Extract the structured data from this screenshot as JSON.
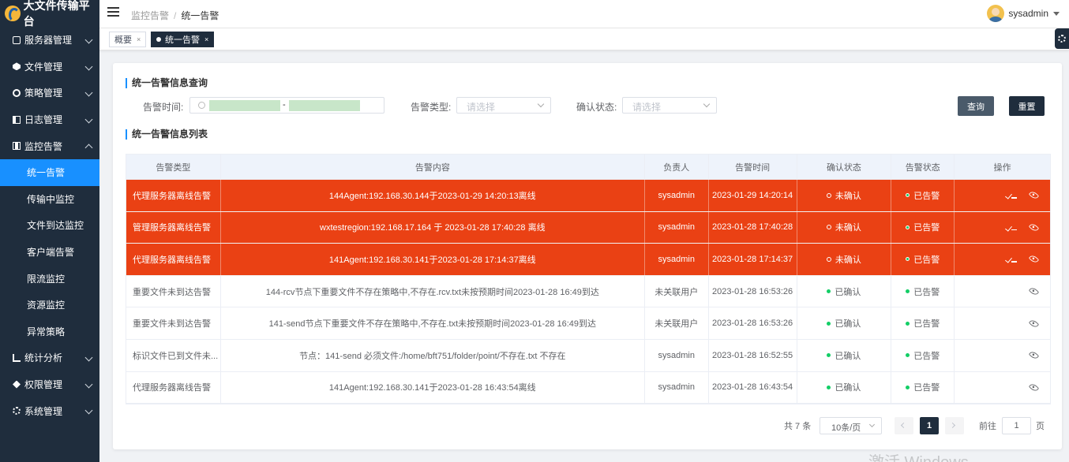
{
  "app": {
    "title": "大文件传输平台"
  },
  "sidebar": {
    "items": [
      {
        "label": "服务器管理",
        "icon": "server-icon"
      },
      {
        "label": "文件管理",
        "icon": "file-icon"
      },
      {
        "label": "策略管理",
        "icon": "policy-icon"
      },
      {
        "label": "日志管理",
        "icon": "log-icon"
      },
      {
        "label": "监控告警",
        "icon": "monitor-icon",
        "expanded": true,
        "children": [
          {
            "label": "统一告警",
            "active": true
          },
          {
            "label": "传输中监控"
          },
          {
            "label": "文件到达监控"
          },
          {
            "label": "客户端告警"
          },
          {
            "label": "限流监控"
          },
          {
            "label": "资源监控"
          },
          {
            "label": "异常策略"
          }
        ]
      },
      {
        "label": "统计分析",
        "icon": "stat-icon"
      },
      {
        "label": "权限管理",
        "icon": "permission-icon"
      },
      {
        "label": "系统管理",
        "icon": "system-icon"
      }
    ]
  },
  "header": {
    "breadcrumb": [
      "监控告警",
      "统一告警"
    ],
    "separator": "/",
    "user": "sysadmin"
  },
  "tabs": [
    {
      "label": "概要",
      "active": false
    },
    {
      "label": "统一告警",
      "active": true
    }
  ],
  "query": {
    "title": "统一告警信息查询",
    "alarm_time_label": "告警时间:",
    "range_separator": "-",
    "alarm_type_label": "告警类型:",
    "alarm_type_placeholder": "请选择",
    "confirm_status_label": "确认状态:",
    "confirm_status_placeholder": "请选择",
    "query_button": "查询",
    "reset_button": "重置"
  },
  "list": {
    "title": "统一告警信息列表",
    "columns": [
      "告警类型",
      "告警内容",
      "负责人",
      "告警时间",
      "确认状态",
      "告警状态",
      "操作"
    ],
    "rows": [
      {
        "type": "代理服务器离线告警",
        "content": "144Agent:192.168.30.144于2023-01-29 14:20:13离线",
        "owner": "sysadmin",
        "time": "2023-01-29 14:20:14",
        "confirm": "未确认",
        "alarm": "已告警",
        "highlight": true
      },
      {
        "type": "管理服务器离线告警",
        "content": "wxtestregion:192.168.17.164 于 2023-01-28 17:40:28 离线",
        "owner": "sysadmin",
        "time": "2023-01-28 17:40:28",
        "confirm": "未确认",
        "alarm": "已告警",
        "highlight": true
      },
      {
        "type": "代理服务器离线告警",
        "content": "141Agent:192.168.30.141于2023-01-28 17:14:37离线",
        "owner": "sysadmin",
        "time": "2023-01-28 17:14:37",
        "confirm": "未确认",
        "alarm": "已告警",
        "highlight": true
      },
      {
        "type": "重要文件未到达告警",
        "content": "144-rcv节点下重要文件不存在策略中,不存在.rcv.txt未按预期时间2023-01-28 16:49到达",
        "owner": "未关联用户",
        "time": "2023-01-28 16:53:26",
        "confirm": "已确认",
        "alarm": "已告警",
        "highlight": false
      },
      {
        "type": "重要文件未到达告警",
        "content": "141-send节点下重要文件不存在策略中,不存在.txt未按预期时间2023-01-28 16:49到达",
        "owner": "未关联用户",
        "time": "2023-01-28 16:53:26",
        "confirm": "已确认",
        "alarm": "已告警",
        "highlight": false
      },
      {
        "type": "标识文件已到文件未...",
        "content": "节点：141-send 必须文件:/home/bft751/folder/point/不存在.txt 不存在",
        "owner": "sysadmin",
        "time": "2023-01-28 16:52:55",
        "confirm": "已确认",
        "alarm": "已告警",
        "highlight": false
      },
      {
        "type": "代理服务器离线告警",
        "content": "141Agent:192.168.30.141于2023-01-28 16:43:54离线",
        "owner": "sysadmin",
        "time": "2023-01-28 16:43:54",
        "confirm": "已确认",
        "alarm": "已告警",
        "highlight": false
      }
    ]
  },
  "pagination": {
    "total": "共 7 条",
    "page_size": "10条/页",
    "current_page": "1",
    "goto_label": "前往",
    "goto_value": "1",
    "goto_suffix": "页"
  },
  "watermark": "激活 Windows",
  "colors": {
    "sidebar": "#1f2d3d",
    "active_menu": "#1890ff",
    "alarm_row": "#ea4114",
    "status_green": "#13ce66"
  }
}
